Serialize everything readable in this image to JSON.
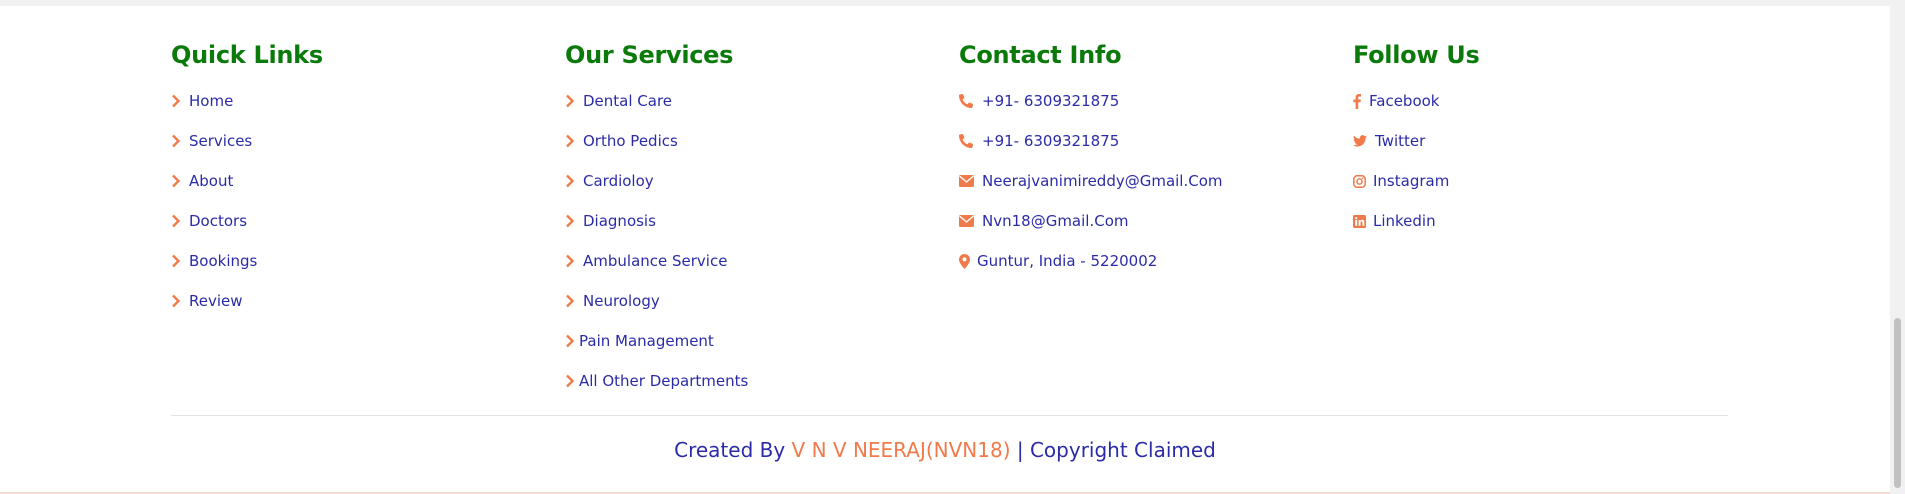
{
  "colors": {
    "heading": "#0a7a0a",
    "link": "#2b2ba8",
    "accent": "#f07a4a",
    "divider": "#e3e3e3"
  },
  "quick_links": {
    "title": "Quick Links",
    "items": [
      {
        "label": "Home",
        "icon": "chevron-right-icon"
      },
      {
        "label": "Services",
        "icon": "chevron-right-icon"
      },
      {
        "label": "About",
        "icon": "chevron-right-icon"
      },
      {
        "label": "Doctors",
        "icon": "chevron-right-icon"
      },
      {
        "label": "Bookings",
        "icon": "chevron-right-icon"
      },
      {
        "label": "Review",
        "icon": "chevron-right-icon"
      }
    ]
  },
  "services": {
    "title": "Our Services",
    "items": [
      {
        "label": "Dental Care",
        "icon": "chevron-right-icon"
      },
      {
        "label": "Ortho Pedics",
        "icon": "chevron-right-icon"
      },
      {
        "label": "Cardioloy",
        "icon": "chevron-right-icon"
      },
      {
        "label": "Diagnosis",
        "icon": "chevron-right-icon"
      },
      {
        "label": "Ambulance Service",
        "icon": "chevron-right-icon"
      },
      {
        "label": "Neurology",
        "icon": "chevron-right-icon"
      },
      {
        "label": "Pain Management",
        "icon": "chevron-right-icon"
      },
      {
        "label": "All Other Departments",
        "icon": "chevron-right-icon"
      }
    ]
  },
  "contact": {
    "title": "Contact Info",
    "items": [
      {
        "label": "+91- 6309321875",
        "icon": "phone-icon"
      },
      {
        "label": "+91- 6309321875",
        "icon": "phone-icon"
      },
      {
        "label": "Neerajvanimireddy@Gmail.Com",
        "icon": "envelope-icon"
      },
      {
        "label": "Nvn18@Gmail.Com",
        "icon": "envelope-icon"
      },
      {
        "label": "Guntur, India - 5220002",
        "icon": "map-marker-icon"
      }
    ]
  },
  "follow": {
    "title": "Follow Us",
    "items": [
      {
        "label": "Facebook",
        "icon": "facebook-icon"
      },
      {
        "label": "Twitter",
        "icon": "twitter-icon"
      },
      {
        "label": "Instagram",
        "icon": "instagram-icon"
      },
      {
        "label": "Linkedin",
        "icon": "linkedin-icon"
      }
    ]
  },
  "footer_credit": {
    "prefix": "Created By",
    "author": "V N V NEERAJ(NVN18)",
    "suffix": "| Copyright Claimed"
  }
}
